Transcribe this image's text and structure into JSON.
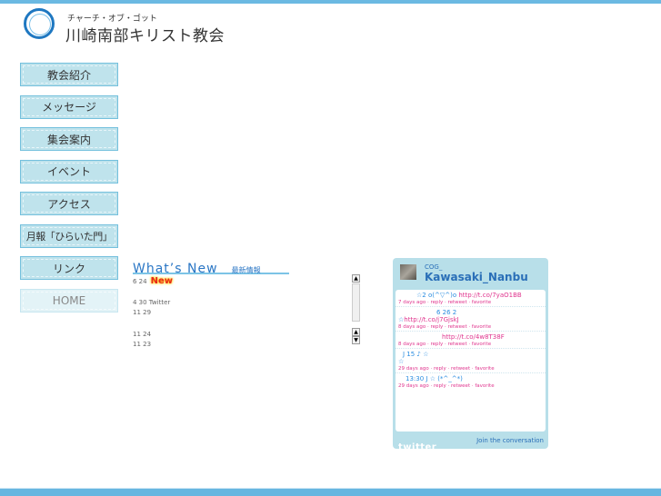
{
  "header": {
    "subtitle": "チャーチ・オブ・ゴット",
    "title": "川崎南部キリスト教会"
  },
  "nav": {
    "items": [
      {
        "label": "教会紹介"
      },
      {
        "label": "メッセージ"
      },
      {
        "label": "集会案内"
      },
      {
        "label": "イベント"
      },
      {
        "label": "アクセス"
      },
      {
        "label": "月報「ひらいた門」"
      },
      {
        "label": "リンク"
      },
      {
        "label": "HOME"
      }
    ]
  },
  "news": {
    "title": "What’s New",
    "subtitle": "最新情報",
    "items": [
      {
        "text": "6 24",
        "badge": "New"
      },
      {
        "text": "4 30  Twitter"
      },
      {
        "text": "11 29"
      },
      {
        "text": "11 24"
      },
      {
        "text": "11 23"
      }
    ]
  },
  "scrollbar": {
    "up_icon": "▲",
    "down_icon": "▼"
  },
  "twitter": {
    "account_small": "COG_",
    "account_name": "Kawasaki_Nanbu",
    "tweets": [
      {
        "text": "☆2      o(^▽^)o ",
        "link": "http://t.co/7yaO1BB",
        "meta": "7 days ago · reply · retweet · favorite"
      },
      {
        "text": "6 26   2",
        "text2": "☆",
        "link": "http://t.co/j7GjskJ",
        "meta": "8 days ago · reply · retweet · favorite"
      },
      {
        "text": "",
        "link": "http://t.co/4w8T38F",
        "meta": "8 days ago · reply · retweet · favorite"
      },
      {
        "text": "J    15                ♪                          ☆",
        "text2": "☆",
        "link": "",
        "meta": "29 days ago · reply · retweet · favorite"
      },
      {
        "text": "13:30  J    ☆       (*^_^*)",
        "link": "",
        "meta": "29 days ago · reply · retweet · favorite"
      }
    ],
    "footer_logo": "twitter",
    "join_label": "Join the conversation"
  }
}
